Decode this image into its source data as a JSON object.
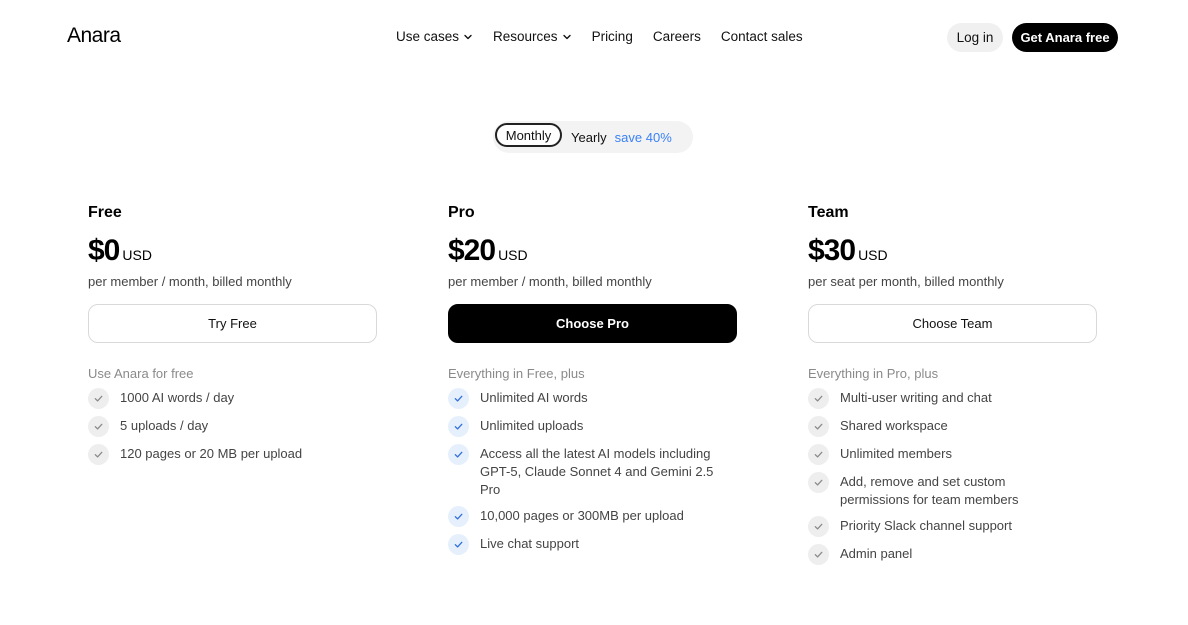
{
  "header": {
    "logo": "Anara",
    "nav": [
      {
        "label": "Use cases",
        "has_dropdown": true
      },
      {
        "label": "Resources",
        "has_dropdown": true
      },
      {
        "label": "Pricing",
        "has_dropdown": false
      },
      {
        "label": "Careers",
        "has_dropdown": false
      },
      {
        "label": "Contact sales",
        "has_dropdown": false
      }
    ],
    "login_label": "Log in",
    "cta_label": "Get Anara free"
  },
  "billing_toggle": {
    "monthly_label": "Monthly",
    "yearly_label": "Yearly",
    "save_label": "save 40%",
    "selected": "Monthly"
  },
  "colors": {
    "accent_blue": "#3b82f6",
    "check_blue_bg": "#e6f0fd",
    "check_grey_bg": "#eeeeee",
    "cta_black": "#000000"
  },
  "icons": {
    "dropdown": "chevron-down-icon",
    "feature": "check-icon"
  },
  "plans": [
    {
      "name": "Free",
      "price": "$0",
      "currency": "USD",
      "billing": "per member / month, billed monthly",
      "button_label": "Try Free",
      "features_intro": "Use Anara for free",
      "features": [
        "1000 AI words / day",
        "5 uploads / day",
        "120 pages or 20 MB per upload"
      ]
    },
    {
      "name": "Pro",
      "price": "$20",
      "currency": "USD",
      "billing": "per member / month, billed monthly",
      "button_label": "Choose Pro",
      "features_intro": "Everything in Free, plus",
      "features": [
        "Unlimited AI words",
        "Unlimited uploads",
        "Access all the latest AI models including GPT-5, Claude Sonnet 4 and Gemini 2.5 Pro",
        "10,000 pages or 300MB per upload",
        "Live chat support"
      ]
    },
    {
      "name": "Team",
      "price": "$30",
      "currency": "USD",
      "billing": "per seat per month, billed monthly",
      "button_label": "Choose Team",
      "features_intro": "Everything in Pro, plus",
      "features": [
        "Multi-user writing and chat",
        "Shared workspace",
        "Unlimited members",
        "Add, remove and set custom permissions for team members",
        "Priority Slack channel support",
        "Admin panel"
      ]
    }
  ]
}
